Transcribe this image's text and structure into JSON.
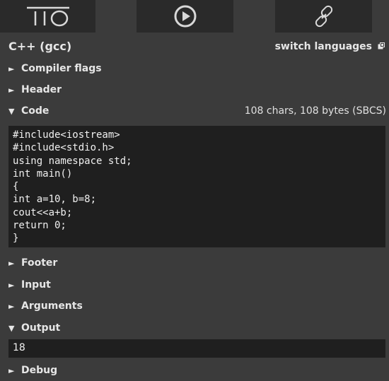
{
  "toolbar": {
    "logo_text": "TIO",
    "run_icon": "run-icon",
    "link_icon": "permalink-icon"
  },
  "language": {
    "name": "C++ (gcc)",
    "switch_label": "switch languages",
    "switch_icon": "external-link-icon"
  },
  "sections": {
    "compiler_flags": {
      "label": "Compiler flags",
      "expanded": false
    },
    "header": {
      "label": "Header",
      "expanded": false
    },
    "code": {
      "label": "Code",
      "expanded": true,
      "stats": "108 chars, 108 bytes (SBCS)",
      "content": "#include<iostream>\n#include<stdio.h>\nusing namespace std;\nint main()\n{\nint a=10, b=8;\ncout<<a+b;\nreturn 0;\n}"
    },
    "footer": {
      "label": "Footer",
      "expanded": false
    },
    "input": {
      "label": "Input",
      "expanded": false
    },
    "arguments": {
      "label": "Arguments",
      "expanded": false
    },
    "output": {
      "label": "Output",
      "expanded": true,
      "content": "18"
    },
    "debug": {
      "label": "Debug",
      "expanded": false
    }
  },
  "glyphs": {
    "collapsed": "►",
    "expanded": "▼"
  },
  "colors": {
    "background": "#3b3b3b",
    "toolbar_button": "#2a2a2a",
    "field_background": "#1f1f1f",
    "text": "#e6e6e6"
  }
}
